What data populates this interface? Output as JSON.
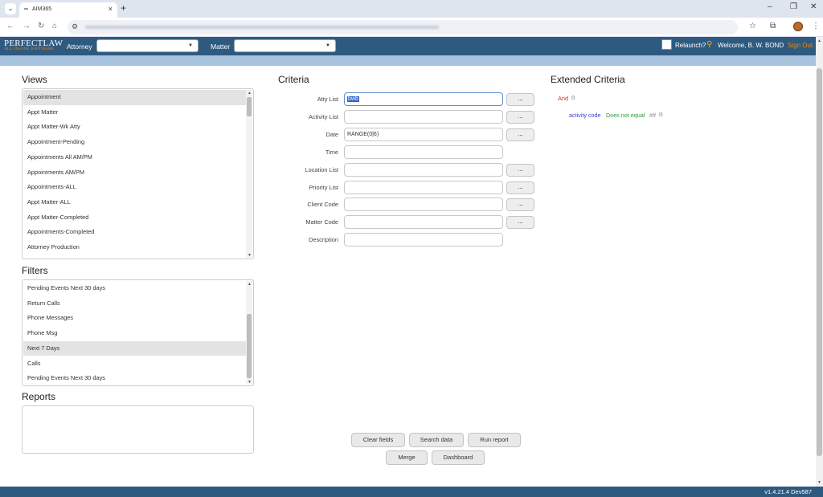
{
  "browser": {
    "tab_title": "AIM365",
    "tab_close": "×",
    "new_tab": "+",
    "win_min": "–",
    "win_max": "❐",
    "win_close": "✕"
  },
  "header": {
    "logo_main": "PERFECTLAW",
    "logo_sub": "ALL-IN-ONE SOFTWARE",
    "attorney_label": "Attorney",
    "matter_label": "Matter",
    "relaunch_label": "Relaunch?",
    "welcome": "Welcome, B. W. BOND",
    "sign_out": "Sign Out"
  },
  "views": {
    "title": "Views",
    "items": [
      "Appointment",
      "Appt Matter",
      "Appt Matter-Wk Atty",
      "Appointment-Pending",
      "Appointments All AM/PM",
      "Appointments AM/PM",
      "Appointments-ALL",
      "Appt Matter-ALL",
      "Appt Matter-Completed",
      "Appointments-Completed",
      "Attorney Production"
    ],
    "selected": 0
  },
  "filters": {
    "title": "Filters",
    "items": [
      "Pending Events Next 30 days",
      "Return Calls",
      "Phone Messages",
      "Phone Msg",
      "Next 7 Days",
      "Calls",
      "Pending Events Next 30 days"
    ],
    "selected": 4
  },
  "reports": {
    "title": "Reports"
  },
  "criteria": {
    "title": "Criteria",
    "fields": [
      {
        "label": "Atty List",
        "value": "bwb",
        "button": "..."
      },
      {
        "label": "Activity List",
        "value": "",
        "button": "..."
      },
      {
        "label": "Date",
        "value": "RANGE(0|6)",
        "button": "..."
      },
      {
        "label": "Time",
        "value": ""
      },
      {
        "label": "Location List",
        "value": "",
        "button": "..."
      },
      {
        "label": "Priority List",
        "value": "",
        "button": "..."
      },
      {
        "label": "Client Code",
        "value": "",
        "button": "..."
      },
      {
        "label": "Matter Code",
        "value": "",
        "button": "..."
      },
      {
        "label": "Description",
        "value": ""
      }
    ]
  },
  "extended": {
    "title": "Extended Criteria",
    "logic": "And",
    "field": "activity code",
    "operator": "Does not equal",
    "value": "##"
  },
  "actions": {
    "clear": "Clear fields",
    "search": "Search data",
    "run": "Run report",
    "merge": "Merge",
    "dashboard": "Dashboard"
  },
  "footer": {
    "version": "v1.4.21.4 Dev587"
  }
}
